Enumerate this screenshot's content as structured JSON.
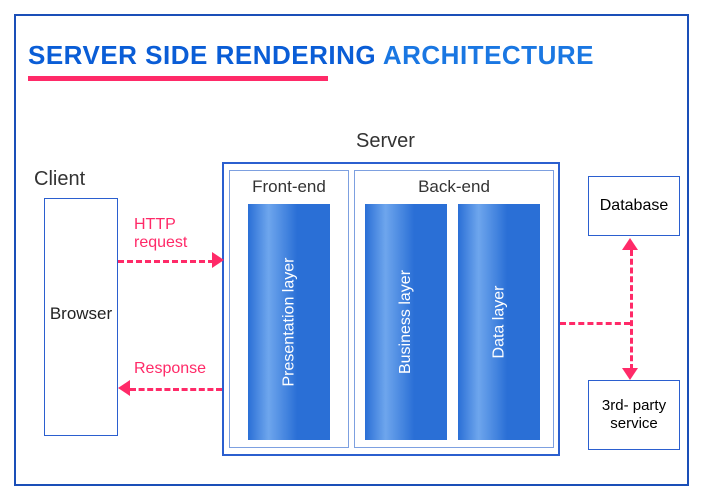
{
  "title": {
    "bold": "SERVER SIDE RENDERING",
    "rest": " ARCHITECTURE"
  },
  "client": {
    "heading": "Client",
    "box": "Browser"
  },
  "server": {
    "heading": "Server",
    "frontend": {
      "heading": "Front-end",
      "layer": "Presentation layer"
    },
    "backend": {
      "heading": "Back-end",
      "business": "Business layer",
      "data": "Data layer"
    }
  },
  "right": {
    "db": "Database",
    "svc": "3rd- party service"
  },
  "arrows": {
    "request": "HTTP request",
    "response": "Response"
  },
  "colors": {
    "accent": "#ff2a68",
    "frame": "#1a4fb8",
    "pillar": "#2a6fd6"
  }
}
